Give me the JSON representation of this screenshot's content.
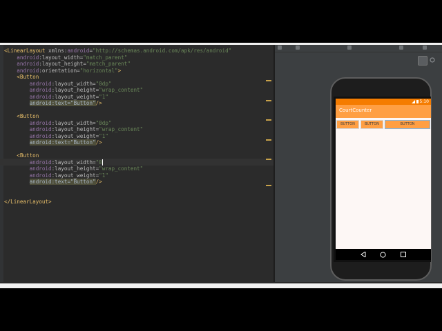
{
  "editor": {
    "lines": [
      {
        "indent": "",
        "parts": [
          [
            "tag",
            "<LinearLayout "
          ],
          [
            "attrname",
            "xmlns:"
          ],
          [
            "attr",
            "android"
          ],
          [
            "attrname",
            "="
          ],
          [
            "val",
            "\"http://schemas.android.com/apk/res/android\""
          ]
        ]
      },
      {
        "indent": "    ",
        "parts": [
          [
            "attr",
            "android"
          ],
          [
            "attrname",
            ":layout_width="
          ],
          [
            "val",
            "\"match_parent\""
          ]
        ]
      },
      {
        "indent": "    ",
        "parts": [
          [
            "attr",
            "android"
          ],
          [
            "attrname",
            ":layout_height="
          ],
          [
            "val",
            "\"match_parent\""
          ]
        ]
      },
      {
        "indent": "    ",
        "parts": [
          [
            "attr",
            "android"
          ],
          [
            "attrname",
            ":orientation="
          ],
          [
            "val",
            "\"horizontal\""
          ],
          [
            "tag",
            ">"
          ]
        ]
      },
      {
        "indent": "    ",
        "parts": [
          [
            "tag",
            "<Button"
          ]
        ]
      },
      {
        "indent": "        ",
        "parts": [
          [
            "attr",
            "android"
          ],
          [
            "attrname",
            ":layout_width="
          ],
          [
            "val",
            "\"0dp\""
          ]
        ]
      },
      {
        "indent": "        ",
        "parts": [
          [
            "attr",
            "android"
          ],
          [
            "attrname",
            ":layout_height="
          ],
          [
            "val",
            "\"wrap_content\""
          ]
        ]
      },
      {
        "indent": "        ",
        "parts": [
          [
            "attr",
            "android"
          ],
          [
            "attrname",
            ":layout_weight="
          ],
          [
            "val",
            "\"1\""
          ]
        ]
      },
      {
        "indent": "        ",
        "parts": [
          [
            "hl",
            "android:text=\"Button\""
          ],
          [
            "tag",
            "/>"
          ]
        ]
      },
      {
        "indent": "",
        "parts": []
      },
      {
        "indent": "    ",
        "parts": [
          [
            "tag",
            "<Button"
          ]
        ]
      },
      {
        "indent": "        ",
        "parts": [
          [
            "attr",
            "android"
          ],
          [
            "attrname",
            ":layout_width="
          ],
          [
            "val",
            "\"0dp\""
          ]
        ]
      },
      {
        "indent": "        ",
        "parts": [
          [
            "attr",
            "android"
          ],
          [
            "attrname",
            ":layout_height="
          ],
          [
            "val",
            "\"wrap_content\""
          ]
        ]
      },
      {
        "indent": "        ",
        "parts": [
          [
            "attr",
            "android"
          ],
          [
            "attrname",
            ":layout_weight="
          ],
          [
            "val",
            "\"1\""
          ]
        ]
      },
      {
        "indent": "        ",
        "parts": [
          [
            "hl",
            "android:text=\"Button\""
          ],
          [
            "tag",
            "/>"
          ]
        ]
      },
      {
        "indent": "",
        "parts": []
      },
      {
        "indent": "    ",
        "parts": [
          [
            "tag",
            "<Button"
          ]
        ]
      },
      {
        "indent": "        ",
        "parts": [
          [
            "attr",
            "android"
          ],
          [
            "attrname",
            ":layout_width="
          ],
          [
            "val",
            "\"0"
          ],
          [
            "caret",
            ""
          ]
        ]
      },
      {
        "indent": "        ",
        "parts": [
          [
            "attr",
            "android"
          ],
          [
            "attrname",
            ":layout_height="
          ],
          [
            "val",
            "\"wrap_content\""
          ]
        ]
      },
      {
        "indent": "        ",
        "parts": [
          [
            "attr",
            "android"
          ],
          [
            "attrname",
            ":layout_weight="
          ],
          [
            "val",
            "\"1\""
          ]
        ]
      },
      {
        "indent": "        ",
        "parts": [
          [
            "hl",
            "android:text=\"Button\""
          ],
          [
            "tag",
            "/>"
          ]
        ]
      },
      {
        "indent": "",
        "parts": []
      },
      {
        "indent": "",
        "parts": []
      },
      {
        "indent": "",
        "parts": [
          [
            "tag",
            "</LinearLayout>"
          ]
        ]
      }
    ]
  },
  "preview": {
    "app_title": "CourtCounter",
    "status_time": "5:10",
    "buttons": [
      "BUTTON",
      "BUTTON",
      "BUTTON"
    ],
    "accent": "#ff9f43",
    "status_color": "#f57c00"
  }
}
